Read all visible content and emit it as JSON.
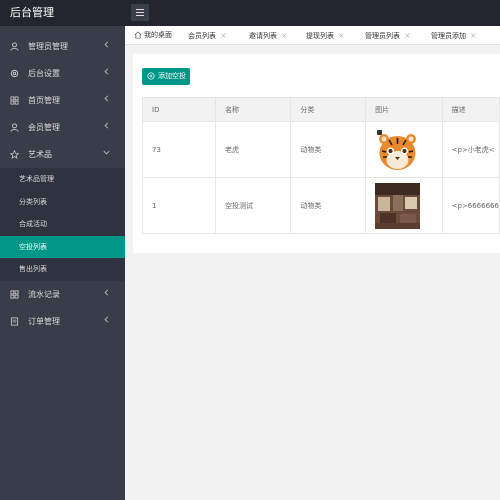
{
  "app": {
    "title": "后台管理"
  },
  "sidebar": {
    "items": [
      {
        "label": "管理员管理",
        "icon": "user-icon"
      },
      {
        "label": "后台设置",
        "icon": "gear-icon"
      },
      {
        "label": "首页管理",
        "icon": "grid-icon"
      },
      {
        "label": "会员管理",
        "icon": "user-icon"
      },
      {
        "label": "艺术品",
        "icon": "star-icon",
        "expanded": true
      },
      {
        "label": "流水记录",
        "icon": "grid-icon"
      },
      {
        "label": "订单管理",
        "icon": "document-icon"
      }
    ],
    "sub_items": [
      {
        "label": "艺术品管理"
      },
      {
        "label": "分类列表"
      },
      {
        "label": "合成活动"
      },
      {
        "label": "空投列表",
        "active": true
      },
      {
        "label": "售出列表"
      }
    ]
  },
  "tabs": [
    {
      "label": "我的桌面"
    },
    {
      "label": "会员列表"
    },
    {
      "label": "邀请列表"
    },
    {
      "label": "提现列表"
    },
    {
      "label": "管理员列表"
    },
    {
      "label": "管理员添加"
    }
  ],
  "toolbar": {
    "add_label": "添加空投"
  },
  "table": {
    "headers": [
      "ID",
      "名称",
      "分类",
      "图片",
      "描述"
    ],
    "rows": [
      {
        "id": "73",
        "name": "老虎",
        "category": "动物类",
        "image": "tiger-image",
        "desc": "<p>小老虎<"
      },
      {
        "id": "1",
        "name": "空投测试",
        "category": "动物类",
        "image": "room-image",
        "desc": "<p>6666666"
      }
    ]
  },
  "colors": {
    "accent": "#009688",
    "sidebar": "#393d49",
    "topbar": "#23262e",
    "subnav": "#2f3340"
  }
}
